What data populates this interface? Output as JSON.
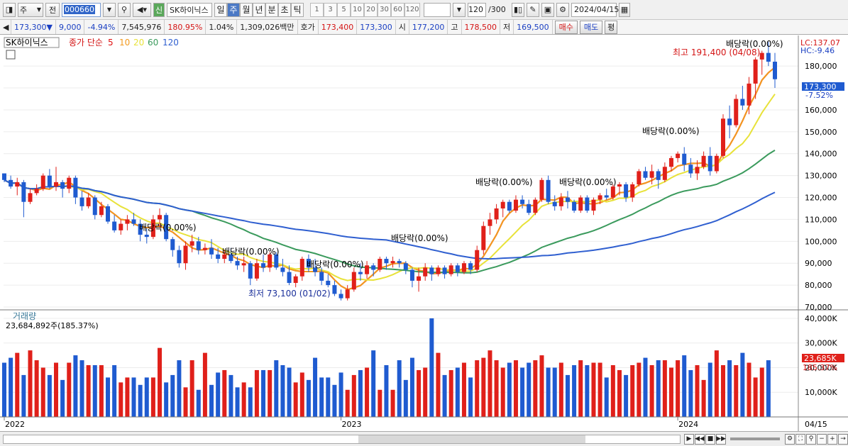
{
  "toolbar": {
    "period_sel": "주",
    "view_sel": "전",
    "code": "000660",
    "stock_name": "SK하이닉스",
    "badge": "신",
    "periods": [
      "일",
      "주",
      "월",
      "년",
      "분",
      "초",
      "틱"
    ],
    "active_period": "주",
    "nums": [
      "1",
      "3",
      "5",
      "10",
      "20",
      "30",
      "60",
      "120"
    ],
    "count": "120",
    "count_max": "/300",
    "date": "2024/04/15"
  },
  "quote": {
    "price": "173,300",
    "arrow": "▼",
    "change": "9,000",
    "pct": "-4.94%",
    "volume": "7,545,976",
    "vol_pct": "180.95%",
    "turnover": "1.04%",
    "amount": "1,309,026백만",
    "bid_label": "호가",
    "bid1": "173,400",
    "bid2": "173,300",
    "open_label": "시",
    "open": "177,200",
    "high_label": "고",
    "high": "178,500",
    "low_label": "저",
    "low": "169,500",
    "buy": "매수",
    "sell": "매도",
    "eval": "평"
  },
  "legend": {
    "name": "SK하이닉스",
    "price_label": "종가 단순",
    "ma": [
      {
        "label": "5",
        "color": "#e01010"
      },
      {
        "label": "10",
        "color": "#f39a1e"
      },
      {
        "label": "20",
        "color": "#e8e23a"
      },
      {
        "label": "60",
        "color": "#3a9a5c"
      },
      {
        "label": "120",
        "color": "#2f5fd0"
      }
    ]
  },
  "axis": {
    "lc": "LC:137.07",
    "hc": "HC:-9.46",
    "price_ticks": [
      "180,000",
      "170,000",
      "160,000",
      "150,000",
      "140,000",
      "130,000",
      "120,000",
      "110,000",
      "100,000",
      "90,000",
      "80,000",
      "70,000"
    ],
    "current_price": "173,300",
    "current_pct": "-7.52%",
    "vol_ticks": [
      "40,000K",
      "30,000K",
      "20,000K",
      "10,000K"
    ],
    "current_vol": "23,685K",
    "current_vol_pct": "185.37%",
    "x_labels": [
      "2022",
      "2023",
      "2024"
    ],
    "last_date": "04/15"
  },
  "annotations": {
    "high": "최고 191,400 (04/08)",
    "low": "최저 73,100 (01/02)",
    "dividend": "배당락(0.00%)"
  },
  "volume_panel": {
    "title": "거래량",
    "info": "23,684,892주(185.37%)"
  },
  "colors": {
    "up": "#e0201a",
    "down": "#1f5bd0"
  },
  "chart_data": {
    "type": "candlestick",
    "ylim": [
      70000,
      193000
    ],
    "candles": [
      [
        131,
        131,
        127,
        128
      ],
      [
        128,
        130,
        124,
        125
      ],
      [
        125,
        129,
        121,
        127
      ],
      [
        127,
        128,
        111,
        118
      ],
      [
        118,
        124,
        117,
        122
      ],
      [
        122,
        126,
        121,
        124
      ],
      [
        124,
        131,
        123,
        130
      ],
      [
        130,
        133,
        124,
        125
      ],
      [
        125,
        134,
        123,
        127
      ],
      [
        127,
        128,
        120,
        124
      ],
      [
        124,
        130,
        122,
        129
      ],
      [
        129,
        130,
        117,
        120
      ],
      [
        120,
        123,
        114,
        116
      ],
      [
        116,
        122,
        115,
        120
      ],
      [
        120,
        121,
        110,
        112
      ],
      [
        112,
        118,
        111,
        116
      ],
      [
        116,
        117,
        108,
        109
      ],
      [
        109,
        112,
        104,
        105
      ],
      [
        105,
        110,
        103,
        108
      ],
      [
        108,
        112,
        105,
        110
      ],
      [
        110,
        113,
        107,
        108
      ],
      [
        108,
        110,
        100,
        103
      ],
      [
        103,
        106,
        99,
        102
      ],
      [
        102,
        112,
        101,
        110
      ],
      [
        110,
        115,
        106,
        112
      ],
      [
        112,
        113,
        100,
        101
      ],
      [
        101,
        102,
        93,
        96
      ],
      [
        96,
        98,
        88,
        90
      ],
      [
        90,
        100,
        87,
        98
      ],
      [
        98,
        103,
        95,
        100
      ],
      [
        100,
        102,
        94,
        96
      ],
      [
        96,
        99,
        94,
        97
      ],
      [
        97,
        101,
        92,
        94
      ],
      [
        94,
        97,
        90,
        92
      ],
      [
        92,
        96,
        90,
        94
      ],
      [
        94,
        97,
        90,
        91
      ],
      [
        91,
        93,
        87,
        89
      ],
      [
        89,
        93,
        86,
        90
      ],
      [
        90,
        91,
        80,
        83
      ],
      [
        83,
        92,
        82,
        90
      ],
      [
        90,
        94,
        86,
        88
      ],
      [
        88,
        95,
        86,
        94
      ],
      [
        94,
        95,
        87,
        88
      ],
      [
        88,
        92,
        84,
        86
      ],
      [
        86,
        89,
        80,
        81
      ],
      [
        81,
        85,
        79,
        84
      ],
      [
        84,
        93,
        82,
        92
      ],
      [
        92,
        94,
        86,
        88
      ],
      [
        88,
        92,
        84,
        86
      ],
      [
        86,
        88,
        80,
        82
      ],
      [
        82,
        85,
        79,
        80
      ],
      [
        80,
        82,
        75,
        76
      ],
      [
        76,
        78,
        73,
        74
      ],
      [
        74,
        80,
        73,
        78
      ],
      [
        78,
        88,
        77,
        86
      ],
      [
        86,
        90,
        82,
        85
      ],
      [
        85,
        91,
        83,
        89
      ],
      [
        89,
        90,
        84,
        87
      ],
      [
        87,
        93,
        86,
        92
      ],
      [
        92,
        93,
        87,
        90
      ],
      [
        90,
        93,
        88,
        91
      ],
      [
        91,
        92,
        88,
        90
      ],
      [
        90,
        91,
        85,
        87
      ],
      [
        87,
        88,
        79,
        82
      ],
      [
        82,
        88,
        77,
        84
      ],
      [
        84,
        90,
        82,
        88
      ],
      [
        88,
        89,
        82,
        85
      ],
      [
        85,
        89,
        84,
        88
      ],
      [
        88,
        89,
        83,
        85
      ],
      [
        85,
        90,
        84,
        89
      ],
      [
        89,
        90,
        84,
        86
      ],
      [
        86,
        91,
        85,
        90
      ],
      [
        90,
        91,
        85,
        87
      ],
      [
        87,
        98,
        86,
        96
      ],
      [
        96,
        109,
        94,
        107
      ],
      [
        107,
        113,
        103,
        110
      ],
      [
        110,
        117,
        108,
        115
      ],
      [
        115,
        119,
        111,
        118
      ],
      [
        118,
        119,
        113,
        114
      ],
      [
        114,
        121,
        113,
        119
      ],
      [
        119,
        121,
        115,
        117
      ],
      [
        117,
        119,
        112,
        113
      ],
      [
        113,
        120,
        112,
        119
      ],
      [
        119,
        129,
        118,
        128
      ],
      [
        128,
        130,
        117,
        118
      ],
      [
        118,
        121,
        114,
        116
      ],
      [
        116,
        122,
        114,
        120
      ],
      [
        120,
        123,
        115,
        118
      ],
      [
        118,
        119,
        113,
        114
      ],
      [
        114,
        121,
        113,
        120
      ],
      [
        120,
        121,
        113,
        114
      ],
      [
        114,
        120,
        112,
        119
      ],
      [
        119,
        122,
        117,
        121
      ],
      [
        121,
        124,
        119,
        120
      ],
      [
        120,
        126,
        119,
        125
      ],
      [
        125,
        127,
        121,
        126
      ],
      [
        126,
        127,
        118,
        120
      ],
      [
        120,
        127,
        118,
        126
      ],
      [
        126,
        133,
        125,
        132
      ],
      [
        132,
        134,
        128,
        129
      ],
      [
        129,
        135,
        126,
        132
      ],
      [
        132,
        133,
        124,
        128
      ],
      [
        128,
        136,
        127,
        134
      ],
      [
        134,
        139,
        132,
        138
      ],
      [
        138,
        141,
        136,
        140
      ],
      [
        140,
        143,
        132,
        135
      ],
      [
        135,
        138,
        129,
        131
      ],
      [
        131,
        137,
        128,
        134
      ],
      [
        134,
        141,
        133,
        139
      ],
      [
        139,
        143,
        130,
        132
      ],
      [
        132,
        140,
        131,
        139
      ],
      [
        139,
        158,
        138,
        156
      ],
      [
        156,
        162,
        147,
        153
      ],
      [
        153,
        167,
        152,
        165
      ],
      [
        165,
        171,
        160,
        162
      ],
      [
        162,
        175,
        158,
        172
      ],
      [
        172,
        184,
        165,
        183
      ],
      [
        183,
        187,
        176,
        186
      ],
      [
        186,
        191,
        180,
        182
      ],
      [
        182,
        186,
        170,
        174
      ]
    ],
    "volume_k": [
      22,
      24,
      26,
      17,
      27,
      23,
      20,
      17,
      22,
      15,
      22,
      25,
      23,
      21,
      21,
      21,
      16,
      21,
      14,
      16,
      16,
      13,
      16,
      16,
      28,
      14,
      17,
      23,
      12,
      23,
      11,
      26,
      13,
      18,
      19,
      17,
      12,
      14,
      12,
      19,
      19,
      19,
      23,
      21,
      20,
      14,
      18,
      15,
      24,
      16,
      16,
      13,
      18,
      11,
      17,
      19,
      20,
      27,
      11,
      21,
      11,
      23,
      15,
      24,
      19,
      20,
      40,
      26,
      17,
      19,
      20,
      22,
      16,
      23,
      24,
      27,
      23,
      20,
      22,
      23,
      20,
      22,
      23,
      25,
      20,
      20,
      22,
      17,
      21,
      23,
      21,
      22,
      22,
      16,
      21,
      19,
      17,
      21,
      22,
      24,
      21,
      23,
      23,
      20,
      23,
      25,
      19,
      21,
      15,
      22,
      27,
      21,
      23,
      21,
      26,
      22,
      16,
      20,
      23
    ],
    "ma_series": {
      "5": "sma",
      "10": "sma",
      "20": "sma",
      "60": "sma",
      "120": "sma"
    }
  }
}
